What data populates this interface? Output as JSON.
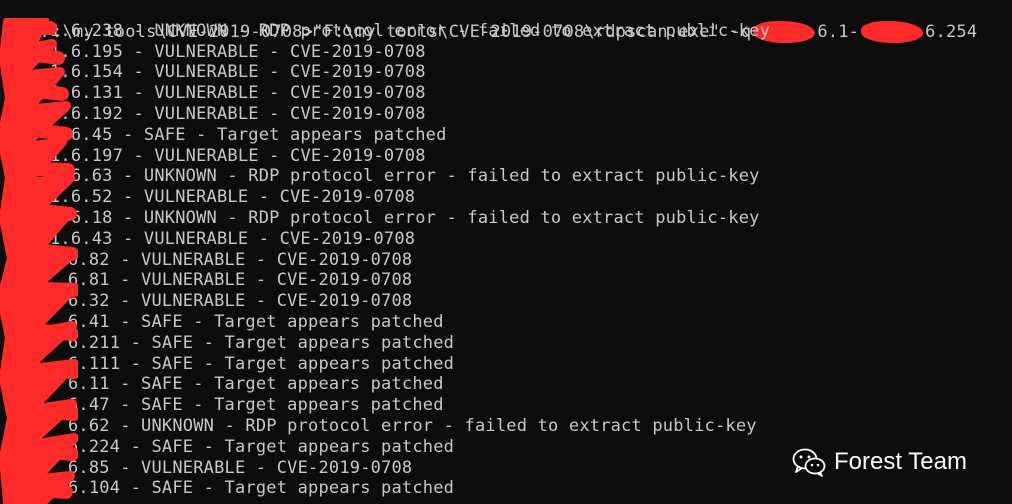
{
  "terminal": {
    "command": {
      "prompt": "F:\\my tools\\CVE-2019-0708>",
      "text_a": "\"F:\\my tools\\CVE-2019-0708\\rdpscan.exe\" -q",
      "text_b": "6.1-",
      "text_c": "6.254"
    },
    "lines": [
      {
        "ip": "1.6.238",
        "result": " - UNKNOWN - RDP protocol error - failed to extract public-key"
      },
      {
        "ip": "1.6.195",
        "result": " - VULNERABLE - CVE-2019-0708"
      },
      {
        "ip": "1.6.154",
        "result": " - VULNERABLE - CVE-2019-0708"
      },
      {
        "ip": "1.6.131",
        "result": " - VULNERABLE - CVE-2019-0708"
      },
      {
        "ip": "1.6.192",
        "result": " - VULNERABLE - CVE-2019-0708"
      },
      {
        "ip": "1.6.45",
        "result": " - SAFE - Target appears patched"
      },
      {
        "ip": "1.6.197",
        "result": " - VULNERABLE - CVE-2019-0708"
      },
      {
        "ip": "1.6.63",
        "result": " - UNKNOWN - RDP protocol error - failed to extract public-key"
      },
      {
        "ip": "1.6.52",
        "result": " - VULNERABLE - CVE-2019-0708"
      },
      {
        "ip": "1.6.18",
        "result": " - UNKNOWN - RDP protocol error - failed to extract public-key"
      },
      {
        "ip": "1.6.43",
        "result": " - VULNERABLE - CVE-2019-0708"
      },
      {
        "ip": "6.82",
        "result": " - VULNERABLE - CVE-2019-0708"
      },
      {
        "ip": "6.81",
        "result": " - VULNERABLE - CVE-2019-0708"
      },
      {
        "ip": "6.32",
        "result": " - VULNERABLE - CVE-2019-0708"
      },
      {
        "ip": "6.41",
        "result": " - SAFE - Target appears patched"
      },
      {
        "ip": "6.211",
        "result": " - SAFE - Target appears patched"
      },
      {
        "ip": "6.111",
        "result": " - SAFE - Target appears patched"
      },
      {
        "ip": "6.11",
        "result": " - SAFE - Target appears patched"
      },
      {
        "ip": "6.47",
        "result": " - SAFE - Target appears patched"
      },
      {
        "ip": "6.62",
        "result": " - UNKNOWN - RDP protocol error - failed to extract public-key"
      },
      {
        "ip": "6.224",
        "result": " - SAFE - Target appears patched"
      },
      {
        "ip": "6.85",
        "result": " - VULNERABLE - CVE-2019-0708"
      },
      {
        "ip": "6.104",
        "result": " - SAFE - Target appears patched"
      }
    ]
  },
  "watermark": {
    "text": "Forest Team",
    "icon": "wechat-icon"
  },
  "colors": {
    "background": "#0c0c0c",
    "text": "#c8c8c8",
    "redaction": "#ff2b2b",
    "watermark": "#ffffff"
  }
}
